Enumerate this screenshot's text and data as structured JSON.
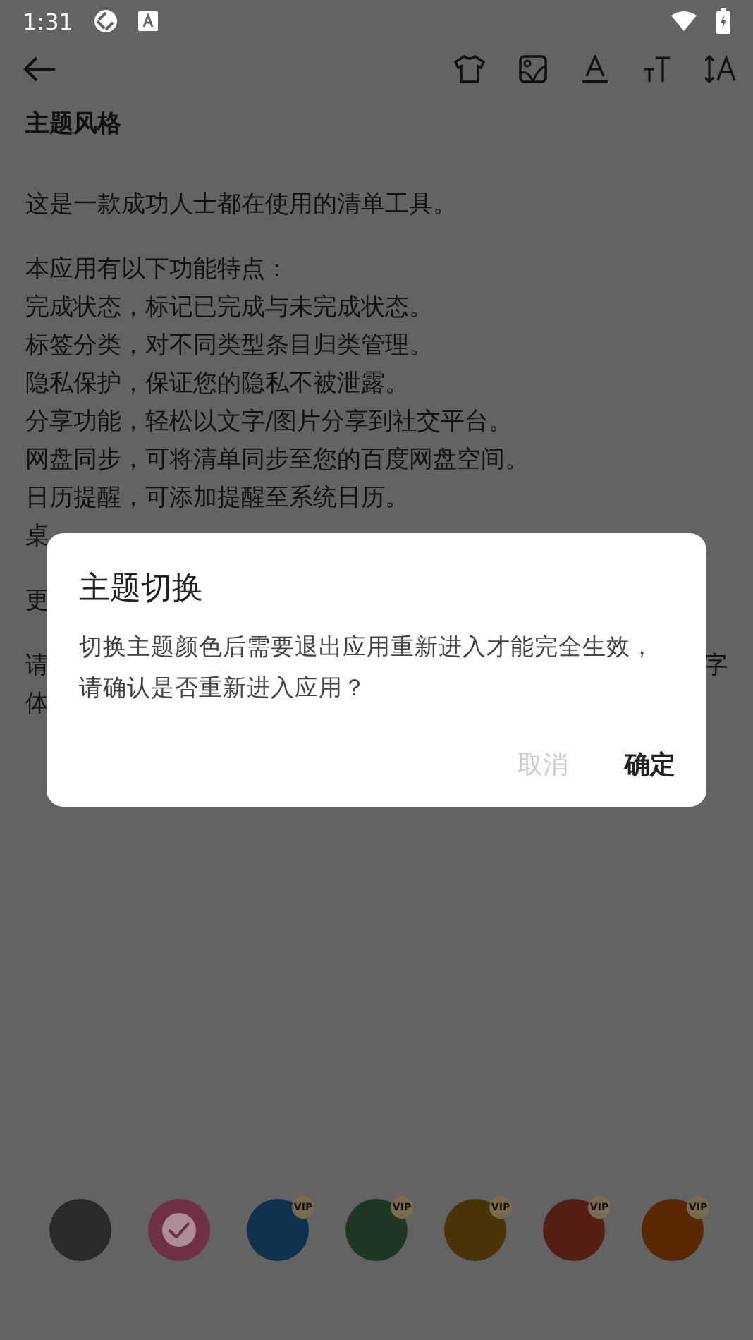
{
  "status_bar": {
    "time": "1:31"
  },
  "toolbar": {
    "title": "主题风格"
  },
  "paragraphs": [
    [
      {
        "kind": "full",
        "text": "这是一款成功人士都在使用的清单工具。"
      }
    ],
    [
      {
        "kind": "full",
        "text": "本应用有以下功能特点："
      },
      {
        "kind": "full",
        "text": "完成状态，标记已完成与未完成状态。"
      },
      {
        "kind": "full",
        "text": "标签分类，对不同类型条目归类管理。"
      },
      {
        "kind": "full",
        "text": "隐私保护，保证您的隐私不被泄露。"
      },
      {
        "kind": "full",
        "text": "分享功能，轻松以文字/图片分享到社交平台。"
      },
      {
        "kind": "full",
        "text": "网盘同步，可将清单同步至您的百度网盘空间。"
      },
      {
        "kind": "full",
        "text": "日历提醒，可添加提醒至系统日历。"
      },
      {
        "kind": "split",
        "left": "桌"
      }
    ],
    [
      {
        "kind": "split",
        "left": "更"
      }
    ],
    [
      {
        "kind": "split",
        "left": "请",
        "right": "字"
      },
      {
        "kind": "split",
        "left": "体"
      }
    ]
  ],
  "dialog": {
    "title": "主题切换",
    "message": "切换主题颜色后需要退出应用重新进入才能完全生效，请确认是否重新进入应用？",
    "buttons": [
      {
        "label": "取消",
        "disabled": true
      },
      {
        "label": "确定",
        "disabled": false
      }
    ]
  },
  "swatches": [
    {
      "color": "#2a2a2a",
      "selected": false
    },
    {
      "color": "#6e3044",
      "selected": true
    },
    {
      "color": "#10304f",
      "selected": false,
      "vip": true,
      "badge": "VIP"
    },
    {
      "color": "#1f3826",
      "selected": false,
      "vip": true,
      "badge": "VIP"
    },
    {
      "color": "#4a3306",
      "selected": false,
      "vip": true,
      "badge": "VIP"
    },
    {
      "color": "#551e14",
      "selected": false,
      "vip": true,
      "badge": "VIP"
    },
    {
      "color": "#5a2800",
      "selected": false,
      "vip": true,
      "badge": "VIP"
    }
  ]
}
